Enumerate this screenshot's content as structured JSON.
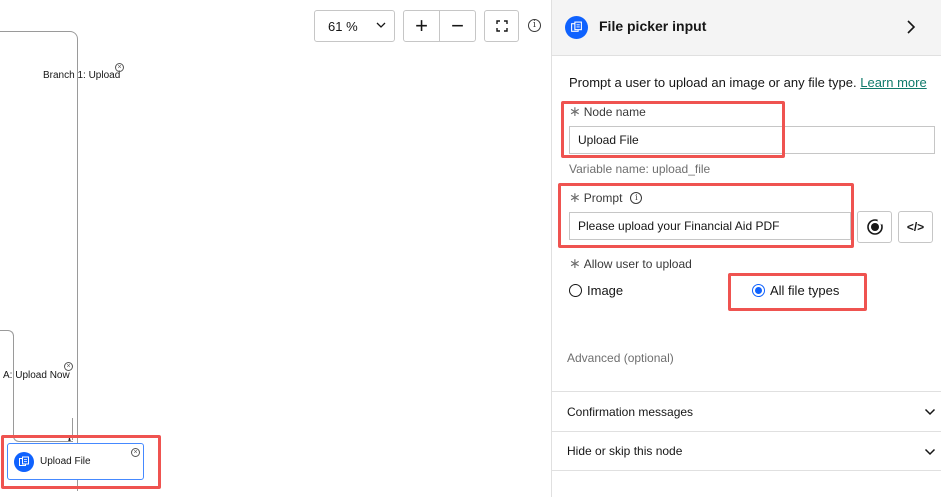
{
  "canvas": {
    "zoom": "61 %",
    "zoom_in": "+",
    "zoom_out": "−",
    "info": "i",
    "branch1_label": "Branch 1: Upload",
    "branch2_label": "A: Upload Now",
    "close_glyph": "×",
    "node": {
      "label": "Upload File"
    },
    "merge_glyph": "\\/\\/"
  },
  "panel": {
    "title": "File picker input",
    "description": "Prompt a user to upload an image or any file type.",
    "learn_more": "Learn more",
    "node_name": {
      "label": "Node name",
      "value": "Upload File"
    },
    "variable": "Variable name: upload_file",
    "prompt": {
      "label": "Prompt",
      "value": "Please upload your Financial Aid PDF"
    },
    "code_button": "</>",
    "allow_upload": {
      "label": "Allow user to upload",
      "options": [
        "Image",
        "All file types"
      ],
      "selected": "All file types"
    },
    "advanced": "Advanced (optional)",
    "accordions": [
      "Confirmation messages",
      "Hide or skip this node"
    ]
  },
  "colors": {
    "accent": "#0f62fe",
    "highlight": "#ef5350",
    "link": "#0f7a6b"
  },
  "icons": [
    "chevron-down-icon",
    "fit-to-screen-icon",
    "info-icon",
    "file-picker-icon",
    "chevron-right-icon",
    "close-circle-icon",
    "ai-assist-icon",
    "code-icon"
  ]
}
